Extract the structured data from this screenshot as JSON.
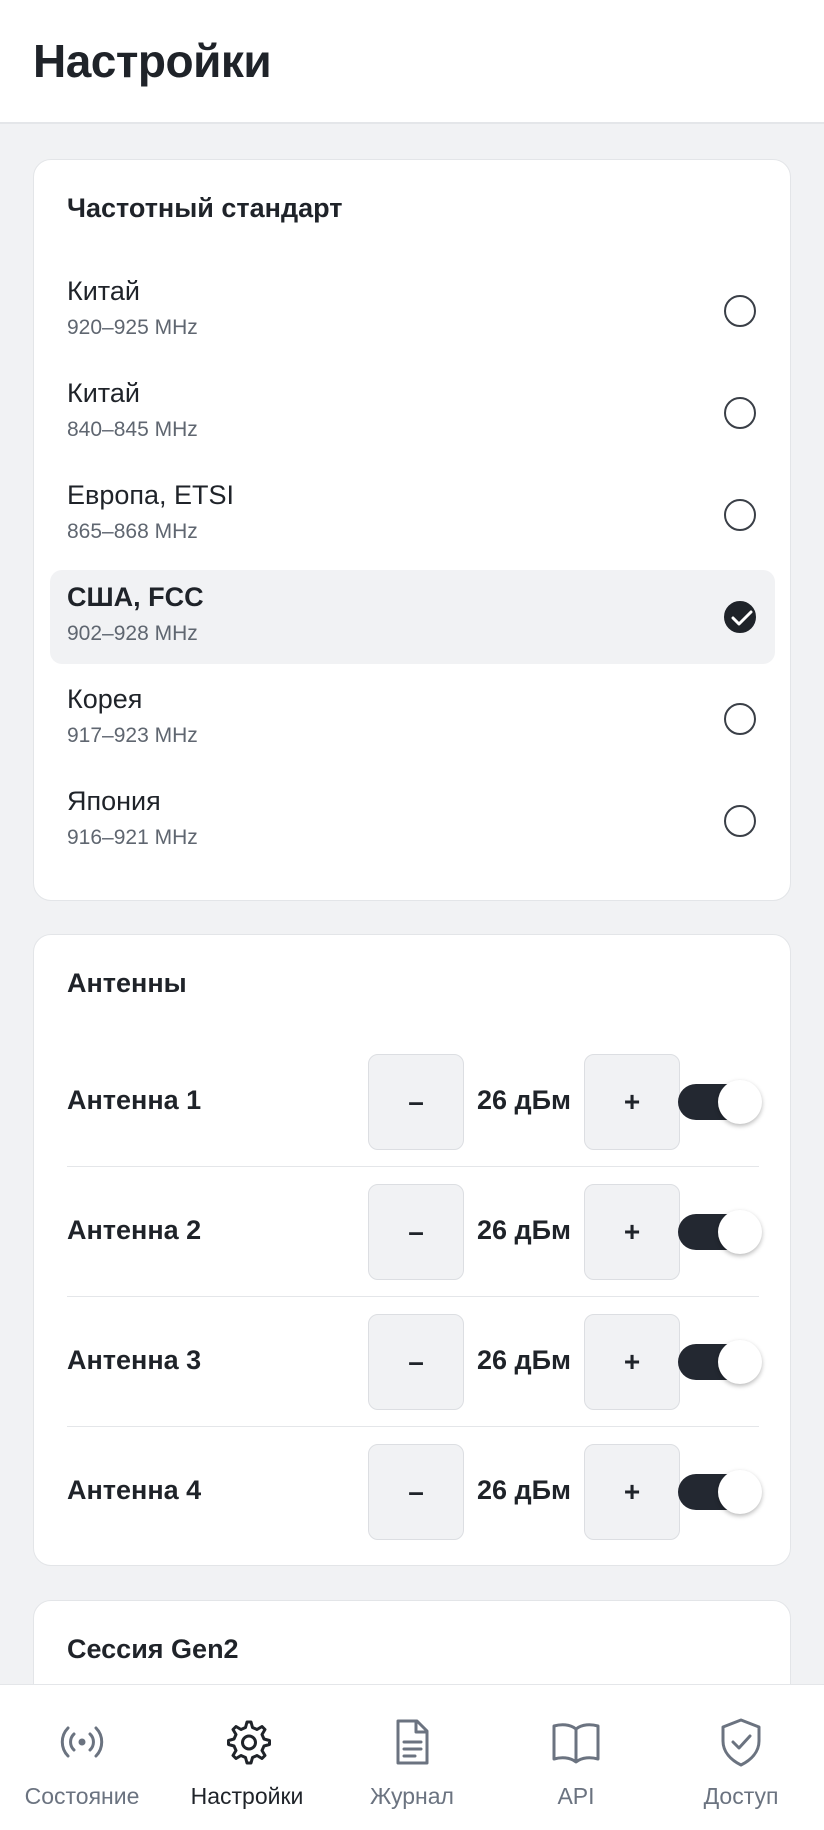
{
  "header": {
    "title": "Настройки"
  },
  "frequency": {
    "title": "Частотный стандарт",
    "items": [
      {
        "name": "Китай",
        "range": "920–925 MHz",
        "selected": false
      },
      {
        "name": "Китай",
        "range": "840–845 MHz",
        "selected": false
      },
      {
        "name": "Европа, ETSI",
        "range": "865–868 MHz",
        "selected": false
      },
      {
        "name": "США, FCC",
        "range": "902–928 MHz",
        "selected": true
      },
      {
        "name": "Корея",
        "range": "917–923 MHz",
        "selected": false
      },
      {
        "name": "Япония",
        "range": "916–921 MHz",
        "selected": false
      }
    ]
  },
  "antennas": {
    "title": "Антенны",
    "minus_label": "–",
    "plus_label": "+",
    "items": [
      {
        "name": "Антенна 1",
        "power": "26 дБм",
        "enabled": true
      },
      {
        "name": "Антенна 2",
        "power": "26 дБм",
        "enabled": true
      },
      {
        "name": "Антенна 3",
        "power": "26 дБм",
        "enabled": true
      },
      {
        "name": "Антенна 4",
        "power": "26 дБм",
        "enabled": true
      }
    ]
  },
  "session": {
    "title": "Сессия Gen2"
  },
  "nav": {
    "items": [
      {
        "label": "Состояние",
        "icon": "broadcast-icon",
        "active": false
      },
      {
        "label": "Настройки",
        "icon": "gear-icon",
        "active": true
      },
      {
        "label": "Журнал",
        "icon": "document-icon",
        "active": false
      },
      {
        "label": "API",
        "icon": "book-icon",
        "active": false
      },
      {
        "label": "Доступ",
        "icon": "shield-check-icon",
        "active": false
      }
    ]
  },
  "colors": {
    "accent": "#1f2329",
    "muted": "#6b7380",
    "background": "#f1f2f4"
  }
}
